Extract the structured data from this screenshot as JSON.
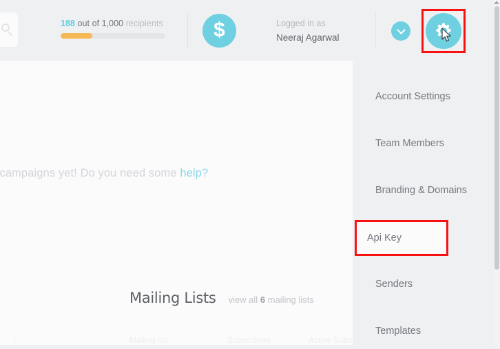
{
  "header": {
    "search": {
      "icon": "search-icon"
    },
    "quota": {
      "count": "188",
      "mid_text": " out of 1,000 ",
      "tail_text": "recipients",
      "fill_percent": 30
    },
    "credits": {
      "icon": "dollar-icon",
      "glyph": "$"
    },
    "account": {
      "logged_in_label": "Logged in as",
      "user_name": "Neeraj Agarwal"
    },
    "chevron": {
      "icon": "chevron-down-icon"
    },
    "settings": {
      "icon": "gear-icon"
    }
  },
  "main": {
    "empty_message_prefix": "ent any campaigns yet! Do you need some ",
    "empty_message_link": "help?",
    "mailing_lists": {
      "title": "Mailing Lists",
      "view_all_prefix": "view all ",
      "view_all_count": "6",
      "view_all_suffix": " mailing lists"
    },
    "table_headers": [
      "|",
      "Mailing list",
      "Subscribers",
      "Active Subs"
    ]
  },
  "dropdown": {
    "items": [
      {
        "label": "Account Settings",
        "highlighted": false
      },
      {
        "label": "Team Members",
        "highlighted": false
      },
      {
        "label": "Branding & Domains",
        "highlighted": false
      },
      {
        "label": "Api Key",
        "highlighted": true
      },
      {
        "label": "Senders",
        "highlighted": false
      },
      {
        "label": "Templates",
        "highlighted": false
      }
    ]
  },
  "colors": {
    "accent_cyan": "#6ed0e0",
    "progress_orange": "#f5b955",
    "highlight_red": "#f91010",
    "header_bg": "#eff0f2",
    "card_bg": "#fbfbfc",
    "text_muted": "#9a9da3"
  }
}
